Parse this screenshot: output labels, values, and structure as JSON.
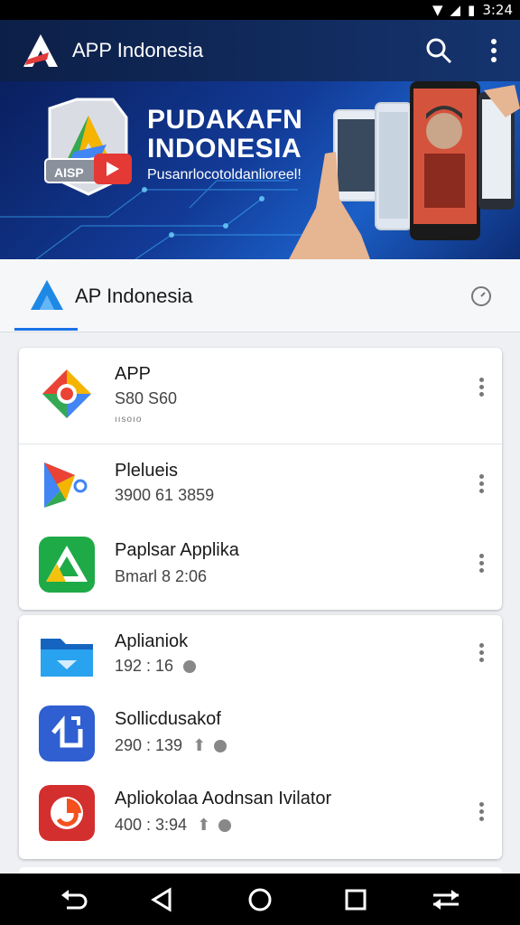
{
  "status_bar": {
    "time": "3:24"
  },
  "app_bar": {
    "title": "APP Indonesia"
  },
  "banner": {
    "headline_1": "PUDAKAFN",
    "headline_2": "INDONESIA",
    "subtitle": "Pusanrlocotoldanlioreel!",
    "badge_text": "AISP"
  },
  "tab": {
    "label": "AP Indonesia"
  },
  "card1": [
    {
      "name": "APP",
      "meta": "S80 S60",
      "small": "ıısoıo"
    },
    {
      "name": "Plelueis",
      "meta": "3900 61 3859"
    },
    {
      "name": "Paplsar Applika",
      "meta": "Bmarl 8 2:06"
    }
  ],
  "card2": [
    {
      "name": "Aplianiok",
      "meta": "192 : 16"
    },
    {
      "name": "Sollicdusakof",
      "meta": "290 : 139"
    },
    {
      "name": "Apliokolaa Aodnsan Ivilator",
      "meta": "400 : 3:94"
    }
  ],
  "colors": {
    "appbar": "#0c1f47",
    "accent": "#1a73e8",
    "card": "#ffffff"
  }
}
